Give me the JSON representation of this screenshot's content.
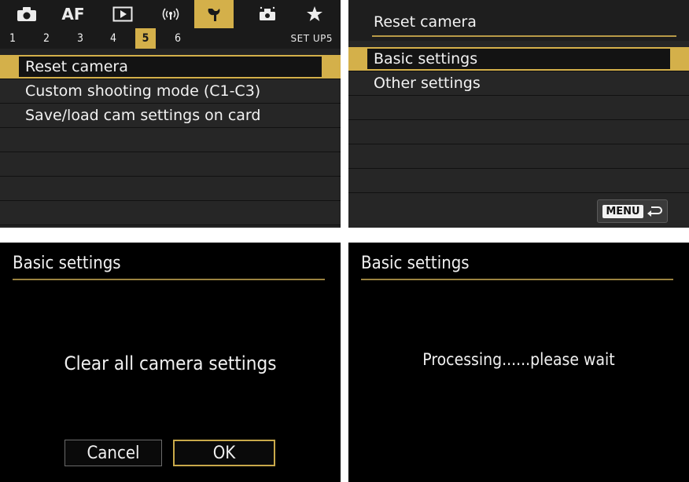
{
  "panel1": {
    "tabs": [
      {
        "icon": "camera-icon"
      },
      {
        "label": "AF"
      },
      {
        "icon": "playback-icon"
      },
      {
        "icon": "wireless-icon"
      },
      {
        "icon": "wrench-icon",
        "active": true
      },
      {
        "icon": "custom-functions-icon"
      },
      {
        "icon": "star-icon"
      }
    ],
    "pages": [
      "1",
      "2",
      "3",
      "4",
      "5",
      "6"
    ],
    "active_page": "5",
    "section_label": "SET UP5",
    "items": [
      "Reset camera",
      "Custom shooting mode (C1-C3)",
      "Save/load cam settings on card"
    ]
  },
  "panel2": {
    "title": "Reset camera",
    "items": [
      "Basic settings",
      "Other settings"
    ],
    "menu_button": "MENU"
  },
  "panel3": {
    "title": "Basic settings",
    "message": "Clear all camera settings",
    "cancel": "Cancel",
    "ok": "OK"
  },
  "panel4": {
    "title": "Basic settings",
    "message": "Processing......please wait"
  },
  "colors": {
    "accent": "#d4b04a",
    "background": "#232323",
    "dialog": "#000000"
  }
}
